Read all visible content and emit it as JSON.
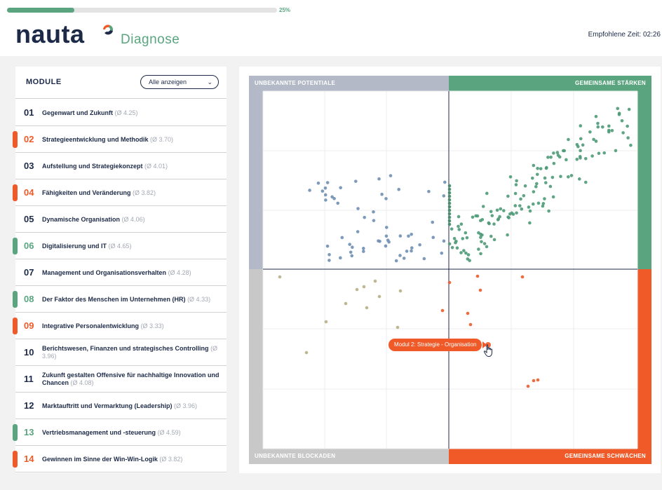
{
  "progress": {
    "percent_label": "25%",
    "value": 0.25
  },
  "header": {
    "logo": "nauta",
    "logo_sub": "Diagnose",
    "time_label": "Empfohlene Zeit: 02:26"
  },
  "sidebar": {
    "title": "MODULE",
    "filter": "Alle anzeigen",
    "modules": [
      {
        "num": "01",
        "label": "Gegenwart und Zukunft",
        "avg": "(Ø 4.25)",
        "status": "none"
      },
      {
        "num": "02",
        "label": "Strategieentwicklung und Methodik",
        "avg": "(Ø 3.70)",
        "status": "weak"
      },
      {
        "num": "03",
        "label": "Aufstellung und Strategiekonzept",
        "avg": "(Ø 4.01)",
        "status": "none"
      },
      {
        "num": "04",
        "label": "Fähigkeiten und Veränderung",
        "avg": "(Ø 3.82)",
        "status": "weak"
      },
      {
        "num": "05",
        "label": "Dynamische Organisation",
        "avg": "(Ø 4.06)",
        "status": "none"
      },
      {
        "num": "06",
        "label": "Digitalisierung und IT",
        "avg": "(Ø 4.65)",
        "status": "strong"
      },
      {
        "num": "07",
        "label": "Management und Organisationsverhalten",
        "avg": "(Ø 4.28)",
        "status": "none"
      },
      {
        "num": "08",
        "label": "Der Faktor des Menschen im Unternehmen (HR)",
        "avg": "(Ø 4.33)",
        "status": "strong"
      },
      {
        "num": "09",
        "label": "Integrative Personalentwicklung",
        "avg": "(Ø 3.33)",
        "status": "weak"
      },
      {
        "num": "10",
        "label": "Berichtswesen, Finanzen und strategisches Controlling",
        "avg": "(Ø 3.96)",
        "status": "none"
      },
      {
        "num": "11",
        "label": "Zukunft gestalten Offensive für nachhaltige Innovation und Chancen",
        "avg": "(Ø 4.08)",
        "status": "none"
      },
      {
        "num": "12",
        "label": "Marktauftritt und Vermarktung (Leadership)",
        "avg": "(Ø 3.96)",
        "status": "none"
      },
      {
        "num": "13",
        "label": "Vertriebsmanagement und -steuerung",
        "avg": "(Ø 4.59)",
        "status": "strong"
      },
      {
        "num": "14",
        "label": "Gewinnen im Sinne der Win-Win-Logik",
        "avg": "(Ø 3.82)",
        "status": "weak"
      }
    ]
  },
  "quadrants": {
    "top_left": "UNBEKANNTE POTENTIALE",
    "top_right": "GEMEINSAME STÄRKEN",
    "bottom_left": "UNBEKANNTE BLOCKADEN",
    "bottom_right": "GEMEINSAME SCHWÄCHEN"
  },
  "tooltip": "Modul 2: Strategie - Organisation",
  "colors": {
    "navy": "#1c2a48",
    "strong": "#5aa57f",
    "weak": "#f05a28",
    "potential": "#b3b9c6",
    "blockade": "#c8c8c8",
    "blue_dot": "#6f8fb4",
    "tan_dot": "#b8ae86"
  }
}
